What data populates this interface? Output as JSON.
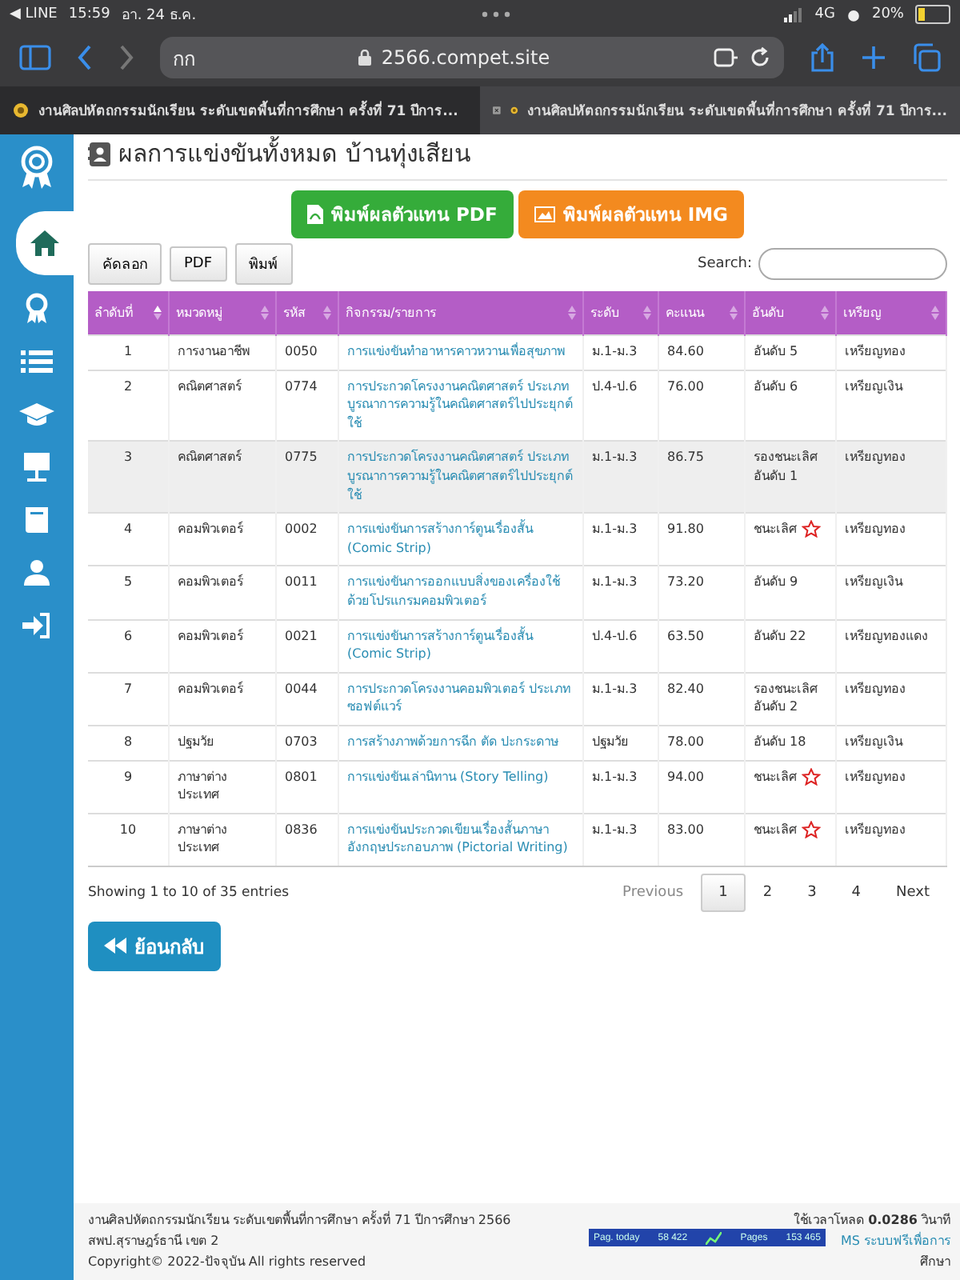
{
  "status_bar": {
    "back_app": "◀ LINE",
    "time": "15:59",
    "date": "อา. 24 ธ.ค.",
    "network": "4G",
    "battery": "20%"
  },
  "browser": {
    "reader_label": "กก",
    "url": "2566.compet.site",
    "tabs": [
      {
        "title": "งานศิลปหัตถกรรมนักเรียน ระดับเขตพื้นที่การศึกษา ครั้งที่ 71 ปีการ...",
        "selected": false
      },
      {
        "title": "งานศิลปหัตถกรรมนักเรียน ระดับเขตพื้นที่การศึกษา ครั้งที่ 71 ปีการ...",
        "selected": true
      }
    ]
  },
  "sidebar": {
    "items": [
      {
        "kind": "home",
        "selected": true
      },
      {
        "kind": "award",
        "selected": false
      },
      {
        "kind": "list",
        "selected": false
      },
      {
        "kind": "cap",
        "selected": false
      },
      {
        "kind": "board",
        "selected": false
      },
      {
        "kind": "book",
        "selected": false
      },
      {
        "kind": "user",
        "selected": false
      },
      {
        "kind": "signin",
        "selected": false
      }
    ]
  },
  "page_title": "ผลการแข่งขันทั้งหมด บ้านทุ่งเสียน",
  "print_buttons": [
    {
      "kind": "pdf",
      "label": "พิมพ์ผลตัวแทน PDF"
    },
    {
      "kind": "img",
      "label": "พิมพ์ผลตัวแทน IMG"
    }
  ],
  "export_buttons": [
    "คัดลอก",
    "PDF",
    "พิมพ์"
  ],
  "search": {
    "label": "Search:"
  },
  "table": {
    "columns": [
      {
        "label": "ลำดับที่",
        "sorted": true
      },
      {
        "label": "หมวดหมู่",
        "sorted": false
      },
      {
        "label": "รหัส",
        "sorted": false
      },
      {
        "label": "กิจกรรม/รายการ",
        "sorted": false
      },
      {
        "label": "ระดับ",
        "sorted": false
      },
      {
        "label": "คะแนน",
        "sorted": false
      },
      {
        "label": "อันดับ",
        "sorted": false
      },
      {
        "label": "เหรียญ",
        "sorted": false
      }
    ],
    "rows": [
      {
        "no": "1",
        "category": "การงานอาชีพ",
        "code": "0050",
        "activity": "การแข่งขันทำอาหารคาวหวานเพื่อสุขภาพ",
        "level": "ม.1-ม.3",
        "score": "84.60",
        "rank": "อันดับ 5",
        "star": false,
        "medal": "เหรียญทอง",
        "highlighted": false
      },
      {
        "no": "2",
        "category": "คณิตศาสตร์",
        "code": "0774",
        "activity": "การประกวดโครงงานคณิตศาสตร์ ประเภทบูรณาการความรู้ในคณิตศาสตร์ไปประยุกต์ใช้",
        "level": "ป.4-ป.6",
        "score": "76.00",
        "rank": "อันดับ 6",
        "star": false,
        "medal": "เหรียญเงิน",
        "highlighted": false
      },
      {
        "no": "3",
        "category": "คณิตศาสตร์",
        "code": "0775",
        "activity": "การประกวดโครงงานคณิตศาสตร์ ประเภทบูรณาการความรู้ในคณิตศาสตร์ไปประยุกต์ใช้",
        "level": "ม.1-ม.3",
        "score": "86.75",
        "rank": "รองชนะเลิศ อันดับ 1",
        "star": false,
        "medal": "เหรียญทอง",
        "highlighted": true
      },
      {
        "no": "4",
        "category": "คอมพิวเตอร์",
        "code": "0002",
        "activity": "การแข่งขันการสร้างการ์ตูนเรื่องสั้น (Comic Strip)",
        "level": "ม.1-ม.3",
        "score": "91.80",
        "rank": "ชนะเลิศ",
        "star": true,
        "medal": "เหรียญทอง",
        "highlighted": false
      },
      {
        "no": "5",
        "category": "คอมพิวเตอร์",
        "code": "0011",
        "activity": "การแข่งขันการออกแบบสิ่งของเครื่องใช้ด้วยโปรแกรมคอมพิวเตอร์",
        "level": "ม.1-ม.3",
        "score": "73.20",
        "rank": "อันดับ 9",
        "star": false,
        "medal": "เหรียญเงิน",
        "highlighted": false
      },
      {
        "no": "6",
        "category": "คอมพิวเตอร์",
        "code": "0021",
        "activity": "การแข่งขันการสร้างการ์ตูนเรื่องสั้น (Comic Strip)",
        "level": "ป.4-ป.6",
        "score": "63.50",
        "rank": "อันดับ 22",
        "star": false,
        "medal": "เหรียญทองแดง",
        "highlighted": false
      },
      {
        "no": "7",
        "category": "คอมพิวเตอร์",
        "code": "0044",
        "activity": "การประกวดโครงงานคอมพิวเตอร์ ประเภทซอฟต์แวร์",
        "level": "ม.1-ม.3",
        "score": "82.40",
        "rank": "รองชนะเลิศ อันดับ 2",
        "star": false,
        "medal": "เหรียญทอง",
        "highlighted": false
      },
      {
        "no": "8",
        "category": "ปฐมวัย",
        "code": "0703",
        "activity": "การสร้างภาพด้วยการฉีก ตัด ปะกระดาษ",
        "level": "ปฐมวัย",
        "score": "78.00",
        "rank": "อันดับ 18",
        "star": false,
        "medal": "เหรียญเงิน",
        "highlighted": false
      },
      {
        "no": "9",
        "category": "ภาษาต่างประเทศ",
        "code": "0801",
        "activity": "การแข่งขันเล่านิทาน (Story Telling)",
        "level": "ม.1-ม.3",
        "score": "94.00",
        "rank": "ชนะเลิศ",
        "star": true,
        "medal": "เหรียญทอง",
        "highlighted": false
      },
      {
        "no": "10",
        "category": "ภาษาต่างประเทศ",
        "code": "0836",
        "activity": "การแข่งขันประกวดเขียนเรื่องสั้นภาษาอังกฤษประกอบภาพ (Pictorial Writing)",
        "level": "ม.1-ม.3",
        "score": "83.00",
        "rank": "ชนะเลิศ",
        "star": true,
        "medal": "เหรียญทอง",
        "highlighted": false
      }
    ]
  },
  "table_info": "Showing 1 to 10 of 35 entries",
  "pagination": [
    {
      "label": "Previous",
      "disabled": true,
      "selected": false
    },
    {
      "label": "1",
      "disabled": false,
      "selected": true
    },
    {
      "label": "2",
      "disabled": false,
      "selected": false
    },
    {
      "label": "3",
      "disabled": false,
      "selected": false
    },
    {
      "label": "4",
      "disabled": false,
      "selected": false
    },
    {
      "label": "Next",
      "disabled": false,
      "selected": false
    }
  ],
  "back_button": "ย้อนกลับ",
  "footer": {
    "left": [
      "งานศิลปหัตถกรรมนักเรียน ระดับเขตพื้นที่การศึกษา ครั้งที่ 71 ปีการศึกษา 2566",
      "สพป.สุราษฎร์ธานี เขต 2",
      "Copyright© 2022-ปัจจุบัน All rights reserved"
    ],
    "load_time": "ใช้เวลาโหลด **0.0286** วินาที",
    "powered": "MS ระบบฟรีเพื่อการ",
    "powered_end": "ศึกษา",
    "counter": {
      "today_label": "Pag. today",
      "today": "58 422",
      "pages_label": "Pages",
      "pages": "153 465"
    }
  }
}
